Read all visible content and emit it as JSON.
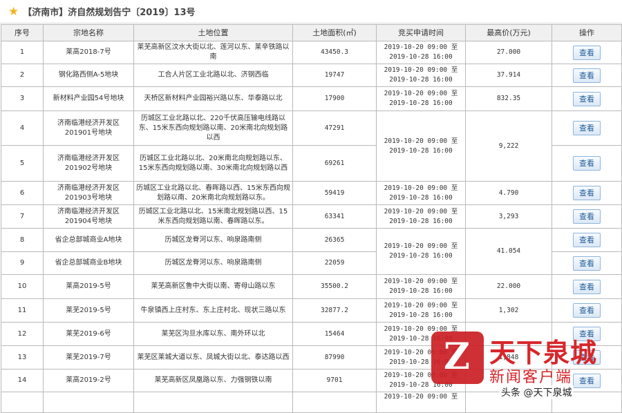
{
  "header": {
    "title": "【济南市】济自然规划告宁〔2019〕13号"
  },
  "table": {
    "columns": [
      "序号",
      "宗地名称",
      "土地位置",
      "土地面积(㎡)",
      "竞买申请时间",
      "最高价(万元)",
      "操作"
    ],
    "action_label": "查看",
    "rows": [
      {
        "no": "1",
        "name": "莱高2018-7号",
        "location": "莱芜高新区汶水大街以北、莲河以东、莱辛铁路以南",
        "area": "43450.3",
        "time": "2019-10-20 09:00 至 2019-10-28 16:00",
        "price": "27.000"
      },
      {
        "no": "2",
        "name": "钢化路西侧A-5地块",
        "location": "工合人片区工业北路以北、济钢西临",
        "area": "19747",
        "time": "2019-10-20 09:00 至 2019-10-28 16:00",
        "price": "37.914"
      },
      {
        "no": "3",
        "name": "新材料产业园54号地块",
        "location": "天桥区新材料产业园裕兴路以东、华泰路以北",
        "area": "17900",
        "time": "2019-10-20 09:00 至 2019-10-28 16:00",
        "price": "832.35"
      },
      {
        "no": "4",
        "name": "济南临港经济开发区201901号地块",
        "location": "历城区工业北路以北、220千伏高压输电线路以东、15米东西向规划路以南、20米南北向规划路以西",
        "area": "47291"
      },
      {
        "no": "5",
        "name": "济南临港经济开发区201902号地块",
        "location": "历城区工业北路以北、20米南北向规划路以东、15米东西向规划路以南、30米南北向规划路以西",
        "area": "69261"
      },
      {
        "no": "6",
        "name": "济南临港经济开发区201903号地块",
        "location": "历城区工业北路以北、春晖路以西、15米东西向规划路以南、20米南北向规划路以东。",
        "area": "59419",
        "time": "2019-10-20 09:00 至 2019-10-28 16:00",
        "price": "4.790"
      },
      {
        "no": "7",
        "name": "济南临港经济开发区201904号地块",
        "location": "历城区工业北路以北、15米南北规划路以西、15米东西向规划路以南、春晖路以东。",
        "area": "63341",
        "time": "2019-10-20 09:00 至 2019-10-28 16:00",
        "price": "3,293"
      },
      {
        "no": "8",
        "name": "省企总部城商业A地块",
        "location": "历城区龙脊河以东、响泉路南侧",
        "area": "26365"
      },
      {
        "no": "9",
        "name": "省企总部城商业B地块",
        "location": "历城区龙脊河以东、响泉路南侧",
        "area": "22059"
      },
      {
        "no": "10",
        "name": "莱高2019-5号",
        "location": "莱芜高新区鲁中大街以南、寄母山路以东",
        "area": "35500.2",
        "time": "2019-10-20 09:00 至 2019-10-28 16:00",
        "price": "22.000"
      },
      {
        "no": "11",
        "name": "莱芜2019-5号",
        "location": "牛泉镇西上庄村东、东上庄村北、现状三路以东",
        "area": "32877.2",
        "time": "2019-10-20 09:00 至 2019-10-28 16:00",
        "price": "1,302"
      },
      {
        "no": "12",
        "name": "莱芜2019-6号",
        "location": "莱芜区沟旦水库以东、南外环以北",
        "area": "15464",
        "time": "2019-10-20 09:00 至 2019-10-28 16:00",
        "price": ""
      },
      {
        "no": "13",
        "name": "莱芜2019-7号",
        "location": "莱芜区莱城大道以东、凤城大街以北、泰达路以西",
        "area": "87990",
        "time": "2019-10-20 09:00 至 2019-10-28 16:00",
        "price": "1,848"
      },
      {
        "no": "14",
        "name": "莱高2019-2号",
        "location": "莱芜高新区凤凰路以东、力强钢铁以南",
        "area": "9701",
        "time": "2019-10-20 09:00 至 2019-10-28 16:00",
        "price": ""
      },
      {
        "no": "",
        "name": "",
        "location": "",
        "area": "",
        "time": "2019-10-20 09:00 至",
        "price": ""
      }
    ],
    "merged": {
      "r45": {
        "time": "2019-10-20 09:00 至 2019-10-28 16:00",
        "price": "9,222"
      },
      "r89": {
        "time": "2019-10-20 09:00 至 2019-10-28 16:00",
        "price": "41.054"
      }
    }
  },
  "watermark": {
    "logo_glyph": "Z",
    "brand": "天下泉城",
    "client": "新闻客户端",
    "credit": "头条 @天下泉城"
  },
  "colors": {
    "header_bg": "#f0f0f0",
    "border": "#b9b9b9",
    "button_text": "#225c99",
    "star": "#f3b21b",
    "watermark_red": "#d7262b"
  }
}
